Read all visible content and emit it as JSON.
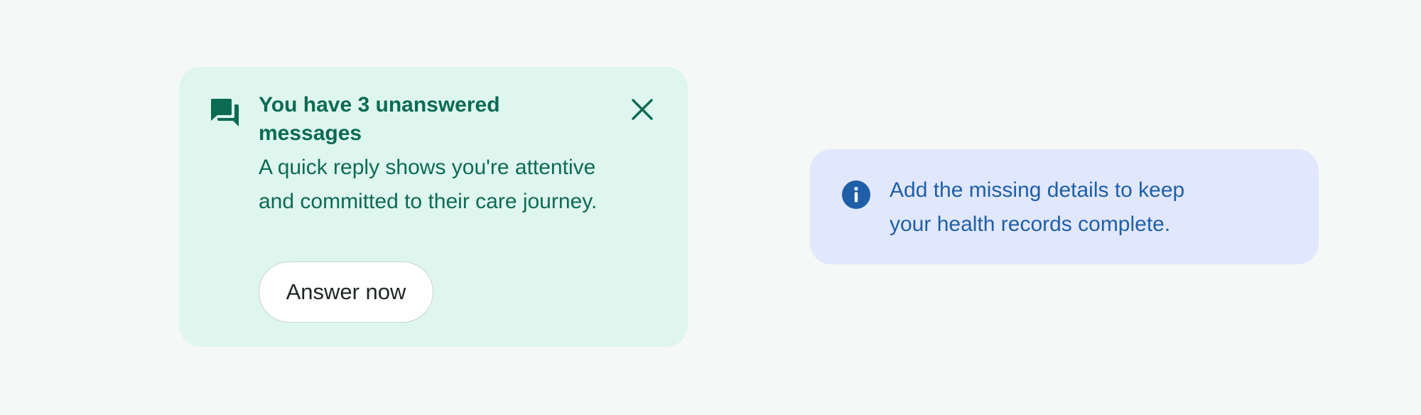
{
  "message_banner": {
    "icon": "chat-bubbles-icon",
    "title": "You have 3 unanswered messages",
    "body": "A quick reply shows you're attentive and committed to their care journey.",
    "close_icon": "close-icon",
    "action_label": "Answer now",
    "colors": {
      "background": "#dff6ef",
      "text": "#0c6b53"
    }
  },
  "info_banner": {
    "icon": "info-icon",
    "text": "Add the missing details to keep your health records complete.",
    "colors": {
      "background": "#e1e7fd",
      "text": "#1f5fa8"
    }
  }
}
